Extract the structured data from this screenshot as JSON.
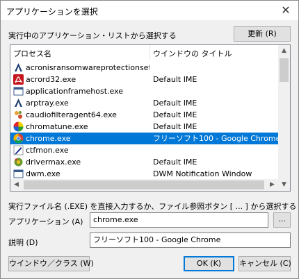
{
  "window": {
    "title": "アプリケーションを選択",
    "close_glyph": "✕"
  },
  "running_label": "実行中のアプリケーション・リストから選択する",
  "refresh_button": "更新 (R)",
  "list": {
    "col_process": "プロセス名",
    "col_title": "ウインドウの タイトル",
    "rows": [
      {
        "name": "acronisransomwareprotectionsetu...",
        "title": "",
        "icon": "acronis-icon"
      },
      {
        "name": "acrord32.exe",
        "title": "Default IME",
        "icon": "acrobat-icon"
      },
      {
        "name": "applicationframehost.exe",
        "title": "",
        "icon": "window-icon"
      },
      {
        "name": "arptray.exe",
        "title": "Default IME",
        "icon": "acronis-icon"
      },
      {
        "name": "caudiofilteragent64.exe",
        "title": "Default IME",
        "icon": "audio-icon"
      },
      {
        "name": "chromatune.exe",
        "title": "Default IME",
        "icon": "color-wheel-icon"
      },
      {
        "name": "chrome.exe",
        "title": "フリーソフト100 - Google Chrome",
        "icon": "chrome-icon",
        "selected": true
      },
      {
        "name": "ctfmon.exe",
        "title": "",
        "icon": "pen-icon"
      },
      {
        "name": "drivermax.exe",
        "title": "Default IME",
        "icon": "gear-icon"
      },
      {
        "name": "dwm.exe",
        "title": "DWM Notification Window",
        "icon": "window-icon"
      }
    ],
    "scroll_up_glyph": "▲",
    "scroll_down_glyph": "▼",
    "scroll_left_glyph": "◀",
    "scroll_right_glyph": "▶"
  },
  "exe_label": "実行ファイル名 (.EXE) を直接入力するか、ファイル参照ボタン [ ... ] から選択する",
  "app_label": "アプリケーション (A)",
  "app_value": "chrome.exe",
  "browse_button": "...",
  "desc_label": "説明 (D)",
  "desc_value": "フリーソフト100 - Google Chrome",
  "window_class_button": "ウインドウ／クラス (W)",
  "ok_button": "OK (K)",
  "cancel_button": "キャンセル (C)",
  "colors": {
    "selection": "#0078d7",
    "dialog_bg": "#f0f0f0"
  }
}
